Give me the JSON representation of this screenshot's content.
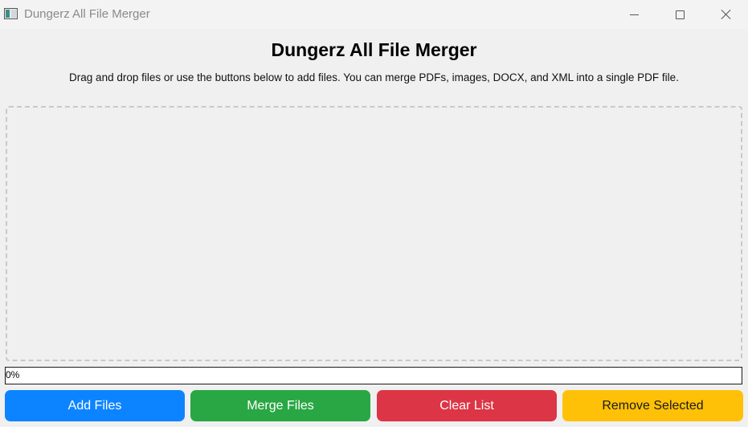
{
  "window": {
    "title": "Dungerz All File Merger",
    "controls": {
      "minimize_icon": "minimize-icon",
      "maximize_icon": "maximize-icon",
      "close_icon": "close-icon"
    }
  },
  "header": {
    "title": "Dungerz All File Merger",
    "description": "Drag and drop files or use the buttons below to add files. You can merge PDFs, images, DOCX, and XML into a single PDF file."
  },
  "drop_zone": {
    "items": []
  },
  "progress": {
    "value": 0,
    "label": "0%"
  },
  "buttons": {
    "add": "Add Files",
    "merge": "Merge Files",
    "clear": "Clear List",
    "remove": "Remove Selected"
  },
  "colors": {
    "add": "#0d84ff",
    "merge": "#29a745",
    "clear": "#dc3546",
    "remove": "#ffc107"
  }
}
